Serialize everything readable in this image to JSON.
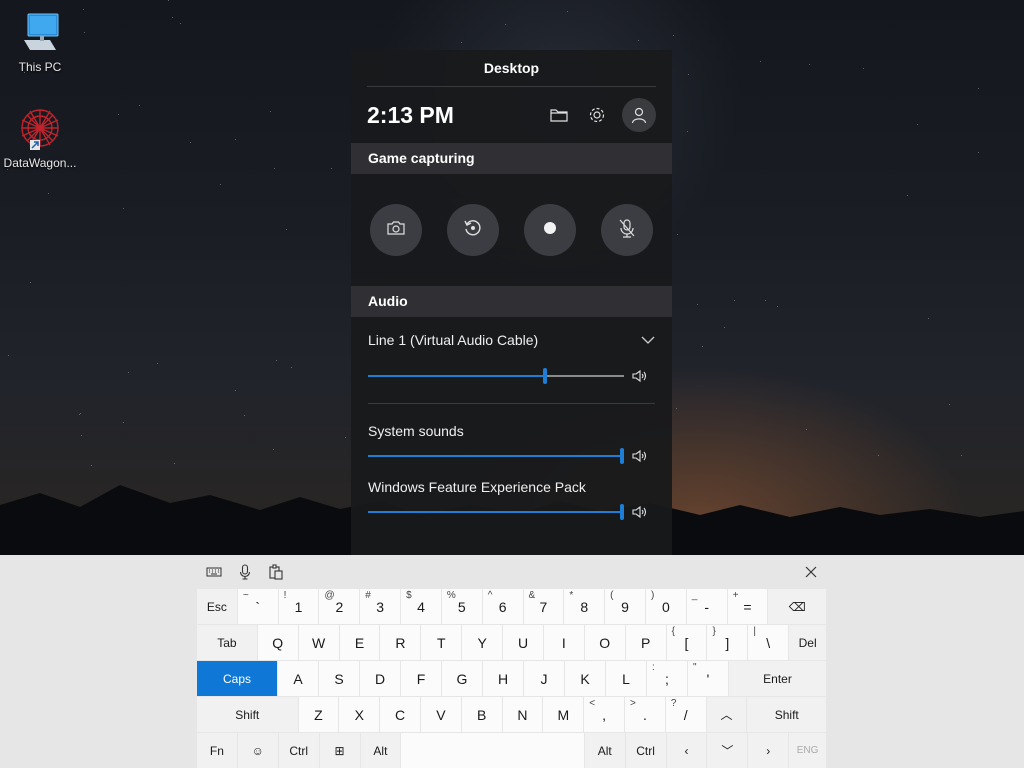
{
  "desktop": {
    "icons": [
      {
        "label": "This PC",
        "icon": "computer-icon"
      },
      {
        "label": "DataWagon...",
        "icon": "datawagon-app-icon"
      }
    ]
  },
  "gamebar": {
    "title": "Desktop",
    "time": "2:13 PM",
    "toolbar_icons": [
      "folder-icon",
      "gear-icon",
      "user-icon"
    ],
    "capture": {
      "heading": "Game capturing",
      "buttons": [
        "camera-icon",
        "replay-icon",
        "record-icon",
        "mic-muted-icon"
      ]
    },
    "audio": {
      "heading": "Audio",
      "device": "Line 1 (Virtual Audio Cable)",
      "device_volume": 0.69,
      "apps": [
        {
          "name": "System sounds",
          "volume": 1.0
        },
        {
          "name": "Windows Feature Experience Pack",
          "volume": 1.0
        }
      ]
    }
  },
  "keyboard": {
    "toolbar": [
      "keyboard-settings-icon",
      "microphone-icon",
      "clipboard-icon",
      "close-icon"
    ],
    "rows": [
      [
        {
          "label": "Esc",
          "dark": true
        },
        {
          "label": "`",
          "sec": "~"
        },
        {
          "label": "1",
          "sec": "!"
        },
        {
          "label": "2",
          "sec": "@"
        },
        {
          "label": "3",
          "sec": "#"
        },
        {
          "label": "4",
          "sec": "$"
        },
        {
          "label": "5",
          "sec": "%"
        },
        {
          "label": "6",
          "sec": "^"
        },
        {
          "label": "7",
          "sec": "&"
        },
        {
          "label": "8",
          "sec": "*"
        },
        {
          "label": "9",
          "sec": "("
        },
        {
          "label": "0",
          "sec": ")"
        },
        {
          "label": "-",
          "sec": "_"
        },
        {
          "label": "=",
          "sec": "+"
        },
        {
          "label": "⌫",
          "dark": true,
          "icon": "backspace-icon"
        }
      ],
      [
        {
          "label": "Tab",
          "dark": true
        },
        {
          "label": "Q"
        },
        {
          "label": "W"
        },
        {
          "label": "E"
        },
        {
          "label": "R"
        },
        {
          "label": "T"
        },
        {
          "label": "Y"
        },
        {
          "label": "U"
        },
        {
          "label": "I"
        },
        {
          "label": "O"
        },
        {
          "label": "P"
        },
        {
          "label": "[",
          "sec": "{"
        },
        {
          "label": "]",
          "sec": "}"
        },
        {
          "label": "\\",
          "sec": "|"
        },
        {
          "label": "Del",
          "dark": true
        }
      ],
      [
        {
          "label": "Caps",
          "caps": true
        },
        {
          "label": "A"
        },
        {
          "label": "S"
        },
        {
          "label": "D"
        },
        {
          "label": "F"
        },
        {
          "label": "G"
        },
        {
          "label": "H"
        },
        {
          "label": "J"
        },
        {
          "label": "K"
        },
        {
          "label": "L"
        },
        {
          "label": ";",
          "sec": ":"
        },
        {
          "label": "'",
          "sec": "\""
        },
        {
          "label": "Enter",
          "dark": true
        }
      ],
      [
        {
          "label": "Shift",
          "dark": true
        },
        {
          "label": "Z"
        },
        {
          "label": "X"
        },
        {
          "label": "C"
        },
        {
          "label": "V"
        },
        {
          "label": "B"
        },
        {
          "label": "N"
        },
        {
          "label": "M"
        },
        {
          "label": ",",
          "sec": "<"
        },
        {
          "label": ".",
          "sec": ">"
        },
        {
          "label": "/",
          "sec": "?"
        },
        {
          "label": "︿",
          "dark": true,
          "icon": "arrow-up-icon"
        },
        {
          "label": "Shift",
          "dark": true
        }
      ],
      [
        {
          "label": "Fn",
          "dark": true
        },
        {
          "label": "☺",
          "dark": true,
          "icon": "emoji-icon"
        },
        {
          "label": "Ctrl",
          "dark": true
        },
        {
          "label": "⊞",
          "dark": true,
          "icon": "windows-icon"
        },
        {
          "label": "Alt",
          "dark": true
        },
        {
          "label": "",
          "space": true
        },
        {
          "label": "Alt",
          "dark": true
        },
        {
          "label": "Ctrl",
          "dark": true
        },
        {
          "label": "‹",
          "dark": true,
          "icon": "arrow-left-icon"
        },
        {
          "label": "﹀",
          "dark": true,
          "icon": "arrow-down-icon"
        },
        {
          "label": "›",
          "dark": true,
          "icon": "arrow-right-icon"
        },
        {
          "label": "ENG",
          "dark": true,
          "muted": true
        }
      ]
    ]
  }
}
